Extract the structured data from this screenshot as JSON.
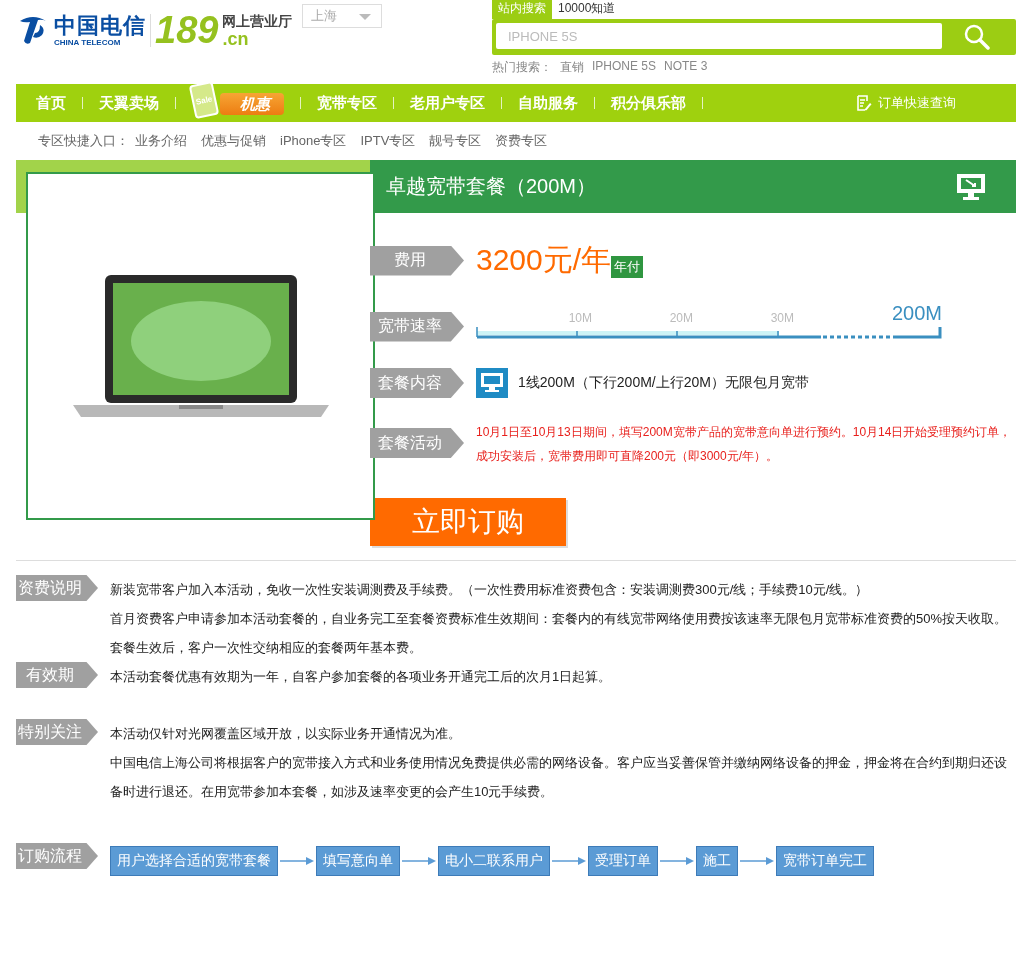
{
  "header": {
    "logo_cn": "中国电信",
    "logo_en": "CHINA TELECOM",
    "logo_number": "189",
    "logo_sub": "网上营业厅",
    "logo_domain": ".cn",
    "city": "上海"
  },
  "search": {
    "tabs": [
      {
        "label": "站内搜索",
        "selected": true
      },
      {
        "label": "10000知道",
        "selected": false
      }
    ],
    "placeholder": "IPHONE 5S",
    "hot_label": "热门搜索：",
    "hot_items": [
      "直销",
      "IPHONE 5S",
      "NOTE 3"
    ]
  },
  "nav": {
    "items": [
      {
        "label": "首页",
        "kind": "text"
      },
      {
        "label": "天翼卖场",
        "kind": "text"
      },
      {
        "label": "机惠",
        "kind": "promo",
        "badge": "Sale"
      },
      {
        "label": "宽带专区",
        "kind": "text"
      },
      {
        "label": "老用户专区",
        "kind": "text"
      },
      {
        "label": "自助服务",
        "kind": "text"
      },
      {
        "label": "积分俱乐部",
        "kind": "text"
      }
    ],
    "order_query": "订单快速查询"
  },
  "quick_links": {
    "label": "专区快捷入口：",
    "items": [
      "业务介绍",
      "优惠与促销",
      "iPhone专区",
      "IPTV专区",
      "靓号专区",
      "资费专区"
    ]
  },
  "product": {
    "title": "卓越宽带套餐（200M）",
    "price_label": "费用",
    "price": "3200元/年",
    "price_badge": "年付",
    "speed_label": "宽带速率",
    "speed_ticks": [
      "10M",
      "20M",
      "30M"
    ],
    "speed_max": "200M",
    "content_label": "套餐内容",
    "content": "1线200M（下行200M/上行20M）无限包月宽带",
    "activity_label": "套餐活动",
    "activity": "10月1日至10月13日期间，填写200M宽带产品的宽带意向单进行预约。10月14日开始受理预约订单，成功安装后，宽带费用即可直降200元（即3000元/年）。",
    "buy_button": "立即订购"
  },
  "details": [
    {
      "label": "资费说明",
      "paragraphs": [
        "新装宽带客户加入本活动，免收一次性安装调测费及手续费。（一次性费用标准资费包含：安装调测费300元/线；手续费10元/线。）",
        "首月资费客户申请参加本活动套餐的，自业务完工至套餐资费标准生效期间：套餐内的有线宽带网络使用费按该速率无限包月宽带标准资费的50%按天收取。",
        "套餐生效后，客户一次性交纳相应的套餐两年基本费。"
      ]
    },
    {
      "label": "有效期",
      "paragraphs": [
        "本活动套餐优惠有效期为一年，自客户参加套餐的各项业务开通完工后的次月1日起算。"
      ]
    },
    {
      "label": "特别关注",
      "paragraphs": [
        "本活动仅针对光网覆盖区域开放，以实际业务开通情况为准。",
        "中国电信上海公司将根据客户的宽带接入方式和业务使用情况免费提供必需的网络设备。客户应当妥善保管并缴纳网络设备的押金，押金将在合约到期归还设备时进行退还。在用宽带参加本套餐，如涉及速率变更的会产生10元手续费。"
      ]
    }
  ],
  "flow": {
    "label": "订购流程",
    "steps": [
      "用户选择合适的宽带套餐",
      "填写意向单",
      "电小二联系用户",
      "受理订单",
      "施工",
      "宽带订单完工"
    ]
  }
}
